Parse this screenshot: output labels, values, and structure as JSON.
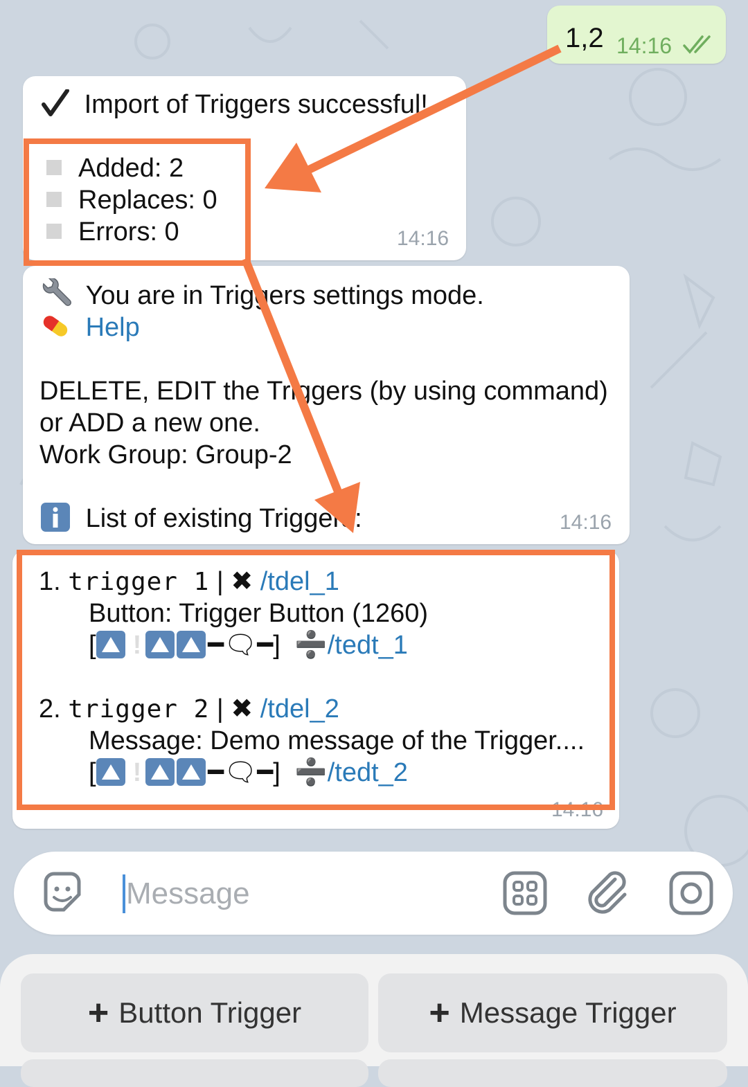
{
  "outgoing": {
    "text": "1,2",
    "time": "14:16",
    "status_icon": "double-check-icon"
  },
  "import_msg": {
    "title_icon": "check-mark",
    "title": "Import of Triggers successful!",
    "stats": [
      "Added: 2",
      "Replaces: 0",
      "Errors: 0"
    ],
    "time": "14:16"
  },
  "settings_msg": {
    "line1_icon": "wrench-icon",
    "line1": "You are in Triggers settings mode.",
    "help_icon": "pill-icon",
    "help_link": "Help",
    "line3": "DELETE, EDIT the Triggers (by using command)",
    "line4": "or ADD a new one.",
    "line5": "Work Group: Group-2",
    "info_icon": "info-icon",
    "line6": "List of existing Triggers:",
    "time": "14:16"
  },
  "triggers_msg": {
    "items": [
      {
        "num": "1.",
        "name": "trigger 1",
        "sep": "|",
        "del_cmd": "/tdel_1",
        "detail": "Button: Trigger Button (1260)",
        "edit_cmd": "/tedt_1"
      },
      {
        "num": "2.",
        "name": "trigger 2",
        "sep": "|",
        "del_cmd": "/tdel_2",
        "detail": "Message: Demo message of the Trigger....",
        "edit_cmd": "/tedt_2"
      }
    ],
    "time": "14:16"
  },
  "composer": {
    "placeholder": "Message"
  },
  "keyboard": {
    "button1": "Button Trigger",
    "button2": "Message Trigger"
  },
  "colors": {
    "accent": "#f47a45",
    "link": "#2a7ab8",
    "outgoing_bg": "#e3f6d0",
    "background": "#cdd6e0"
  }
}
